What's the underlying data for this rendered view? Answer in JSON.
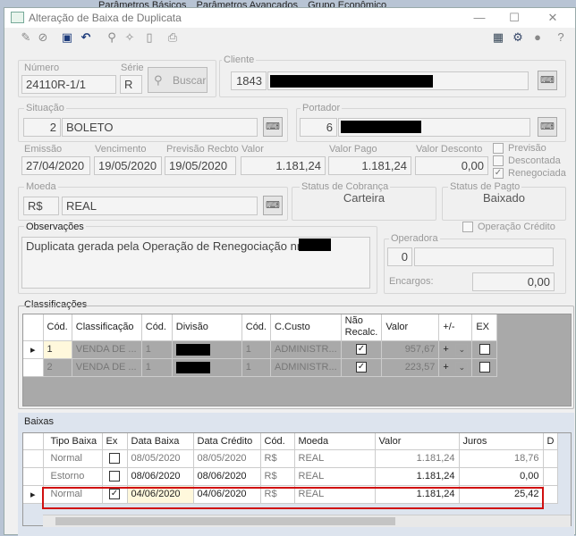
{
  "background_tabs": [
    "Parâmetros Básicos",
    "Parâmetros Avançados",
    "Grupo Econômico"
  ],
  "window": {
    "title": "Alteração de Baixa de Duplicata"
  },
  "toolbar_icons": [
    "edit-icon",
    "cancel-icon",
    "save-icon",
    "undo-icon",
    "search-icon",
    "tools-icon",
    "eraser-icon",
    "print-icon",
    "calculator-icon",
    "gear-icon",
    "user-icon",
    "help-icon"
  ],
  "header": {
    "numero_label": "Número",
    "numero_value": "24110R-1/1",
    "serie_label": "Série",
    "serie_value": "R",
    "buscar_label": "Buscar",
    "cliente_label": "Cliente",
    "cliente_code": "1843"
  },
  "situacao": {
    "label": "Situação",
    "code": "2",
    "name": "BOLETO"
  },
  "portador": {
    "label": "Portador",
    "code": "6"
  },
  "dates": {
    "emissao_label": "Emissão",
    "emissao": "27/04/2020",
    "vencimento_label": "Vencimento",
    "vencimento": "19/05/2020",
    "previsao_label": "Previsão Recbto",
    "previsao": "19/05/2020",
    "valor_label": "Valor",
    "valor": "1.181,24",
    "valor_pago_label": "Valor Pago",
    "valor_pago": "1.181,24",
    "valor_desconto_label": "Valor Desconto",
    "valor_desconto": "0,00"
  },
  "flags": [
    {
      "label": "Previsão",
      "checked": false
    },
    {
      "label": "Descontada",
      "checked": false
    },
    {
      "label": "Renegociada",
      "checked": true
    }
  ],
  "moeda": {
    "label": "Moeda",
    "symbol": "R$",
    "name": "REAL"
  },
  "status_cobranca": {
    "label": "Status de Cobrança",
    "value": "Carteira"
  },
  "status_pagto": {
    "label": "Status de Pagto",
    "value": "Baixado"
  },
  "observacoes": {
    "label": "Observações",
    "text": "Duplicata gerada pela Operação de Renegociação nr."
  },
  "operacao_credito": {
    "label": "Operação Crédito",
    "checked": false
  },
  "operadora": {
    "label": "Operadora",
    "code": "0"
  },
  "encargos": {
    "label": "Encargos:",
    "value": "0,00"
  },
  "classificacoes": {
    "title": "Classificações",
    "columns": [
      "Cód.",
      "Classificação",
      "Cód.",
      "Divisão",
      "Cód.",
      "C.Custo",
      "Não Recalc.",
      "Valor",
      "+/-",
      "EX"
    ],
    "rows": [
      {
        "cod": "1",
        "classificacao": "VENDA DE ...",
        "cod_div": "1",
        "cod_cc": "1",
        "ccusto": "ADMINISTR...",
        "nao_recalc": true,
        "valor": "957,67",
        "sinal": "+",
        "ex": false
      },
      {
        "cod": "2",
        "classificacao": "VENDA DE ...",
        "cod_div": "1",
        "cod_cc": "1",
        "ccusto": "ADMINISTR...",
        "nao_recalc": true,
        "valor": "223,57",
        "sinal": "+",
        "ex": false
      }
    ]
  },
  "baixas": {
    "title": "Baixas",
    "columns": [
      "Tipo Baixa",
      "Ex",
      "Data Baixa",
      "Data Crédito",
      "Cód.",
      "Moeda",
      "Valor",
      "Juros",
      "D"
    ],
    "rows": [
      {
        "tipo": "Normal",
        "ex": false,
        "data_baixa": "08/05/2020",
        "data_credito": "08/05/2020",
        "cod": "R$",
        "moeda": "REAL",
        "valor": "1.181,24",
        "juros": "18,76"
      },
      {
        "tipo": "Estorno",
        "ex": false,
        "data_baixa": "08/06/2020",
        "data_credito": "08/06/2020",
        "cod": "R$",
        "moeda": "REAL",
        "valor": "1.181,24",
        "juros": "0,00"
      },
      {
        "tipo": "Normal",
        "ex": true,
        "data_baixa": "04/06/2020",
        "data_credito": "04/06/2020",
        "cod": "R$",
        "moeda": "REAL",
        "valor": "1.181,24",
        "juros": "25,42"
      }
    ]
  }
}
